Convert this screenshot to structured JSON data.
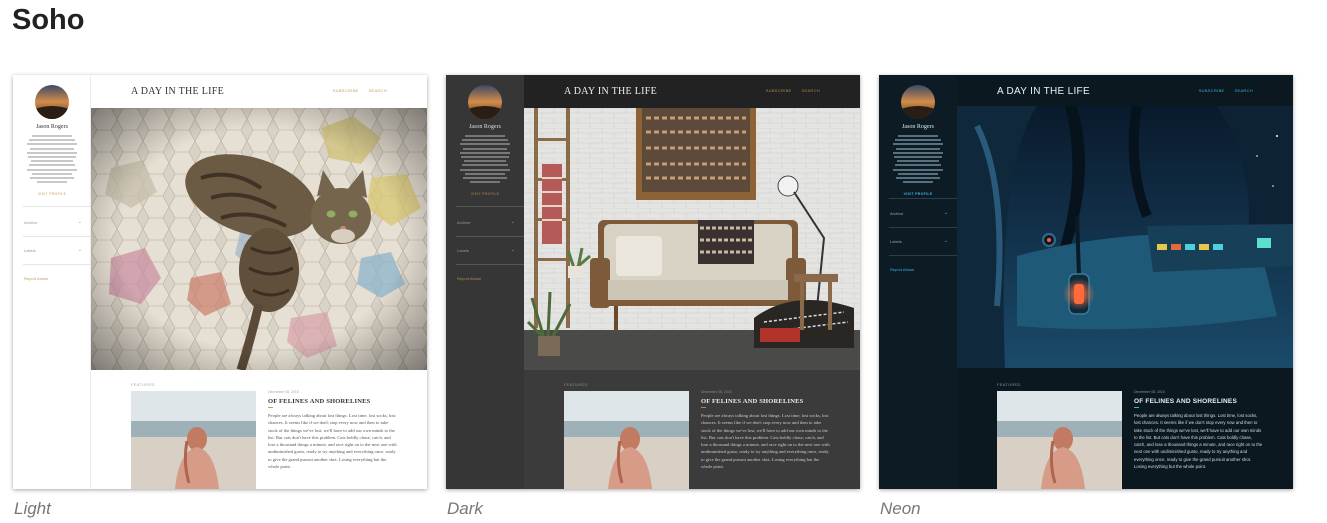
{
  "section_title": "Soho",
  "themes": [
    {
      "id": "light",
      "caption": "Light"
    },
    {
      "id": "dark",
      "caption": "Dark"
    },
    {
      "id": "neon",
      "caption": "Neon"
    }
  ],
  "blog": {
    "site_title": "A DAY IN THE LIFE",
    "nav_subscribe": "SUBSCRIBE",
    "nav_search": "SEARCH",
    "author_name": "Jason Rogers",
    "visit_profile": "VISIT PROFILE",
    "archive_label": "Archive",
    "labels_label": "Labels",
    "report_abuse": "Report Abuse",
    "featured_label": "FEATURED",
    "post_date": "December 08, 2016",
    "post_title": "OF FELINES AND SHORELINES",
    "post_excerpt": "People are always talking about lost things. Lost time, lost socks, lost chances. It seems like if we don't stop every now and then to take stock of the things we've lost, we'll have to add our own minds to the list. But cats don't have this problem. Cats boldly chase, catch, and lose a thousand things a minute, and race right on to the next one with undiminished gusto, ready to try anything and everything once, ready to give the grand pursuit another shot. Losing everything but the whole point."
  },
  "colors": {
    "light_accent": "#c49c5a",
    "dark_accent": "#b08a4e",
    "neon_accent": "#39b5e0"
  }
}
